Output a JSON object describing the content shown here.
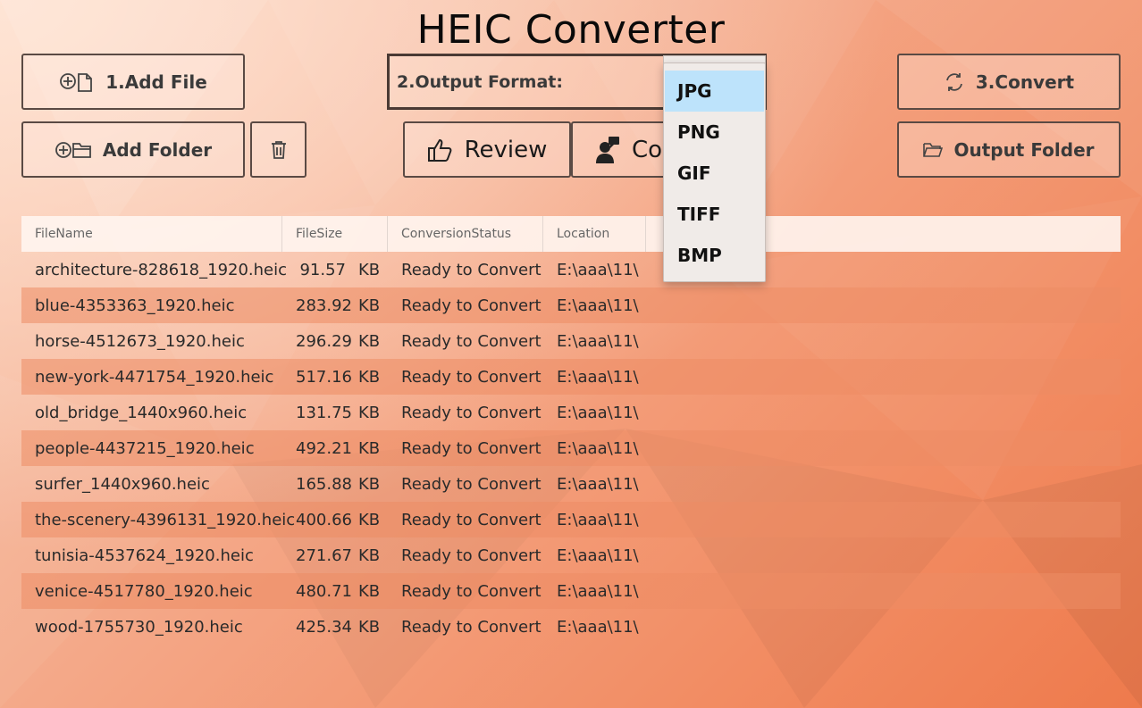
{
  "app": {
    "title": "HEIC Converter"
  },
  "toolbar": {
    "add_file": "1.Add File",
    "add_folder": "Add Folder",
    "output_format_label": "2.Output Format:",
    "review": "Review",
    "comment_partial": "Co",
    "convert": "3.Convert",
    "output_folder": "Output Folder"
  },
  "format_dropdown": {
    "selected": "JPG",
    "options": [
      "JPG",
      "PNG",
      "GIF",
      "TIFF",
      "BMP"
    ]
  },
  "table": {
    "columns": [
      "FileName",
      "FileSize",
      "ConversionStatus",
      "Location"
    ],
    "size_unit": "KB",
    "rows": [
      {
        "name": "architecture-828618_1920.heic",
        "size": "91.57",
        "status": "Ready to Convert",
        "location": "E:\\aaa\\11\\"
      },
      {
        "name": "blue-4353363_1920.heic",
        "size": "283.92",
        "status": "Ready to Convert",
        "location": "E:\\aaa\\11\\"
      },
      {
        "name": "horse-4512673_1920.heic",
        "size": "296.29",
        "status": "Ready to Convert",
        "location": "E:\\aaa\\11\\"
      },
      {
        "name": "new-york-4471754_1920.heic",
        "size": "517.16",
        "status": "Ready to Convert",
        "location": "E:\\aaa\\11\\"
      },
      {
        "name": "old_bridge_1440x960.heic",
        "size": "131.75",
        "status": "Ready to Convert",
        "location": "E:\\aaa\\11\\"
      },
      {
        "name": "people-4437215_1920.heic",
        "size": "492.21",
        "status": "Ready to Convert",
        "location": "E:\\aaa\\11\\"
      },
      {
        "name": "surfer_1440x960.heic",
        "size": "165.88",
        "status": "Ready to Convert",
        "location": "E:\\aaa\\11\\"
      },
      {
        "name": "the-scenery-4396131_1920.heic",
        "size": "400.66",
        "status": "Ready to Convert",
        "location": "E:\\aaa\\11\\"
      },
      {
        "name": "tunisia-4537624_1920.heic",
        "size": "271.67",
        "status": "Ready to Convert",
        "location": "E:\\aaa\\11\\"
      },
      {
        "name": "venice-4517780_1920.heic",
        "size": "480.71",
        "status": "Ready to Convert",
        "location": "E:\\aaa\\11\\"
      },
      {
        "name": "wood-1755730_1920.heic",
        "size": "425.34",
        "status": "Ready to Convert",
        "location": "E:\\aaa\\11\\"
      }
    ]
  },
  "colors": {
    "accent": "#ee7a4c",
    "selected_option": "#bde3fb",
    "border": "#5a4a44"
  },
  "icons": {
    "add_file": "add-file-icon",
    "add_folder": "add-folder-icon",
    "delete": "trash-icon",
    "review": "thumbs-up-icon",
    "comment": "user-comment-icon",
    "convert": "refresh-icon",
    "output_folder": "folder-open-icon"
  }
}
